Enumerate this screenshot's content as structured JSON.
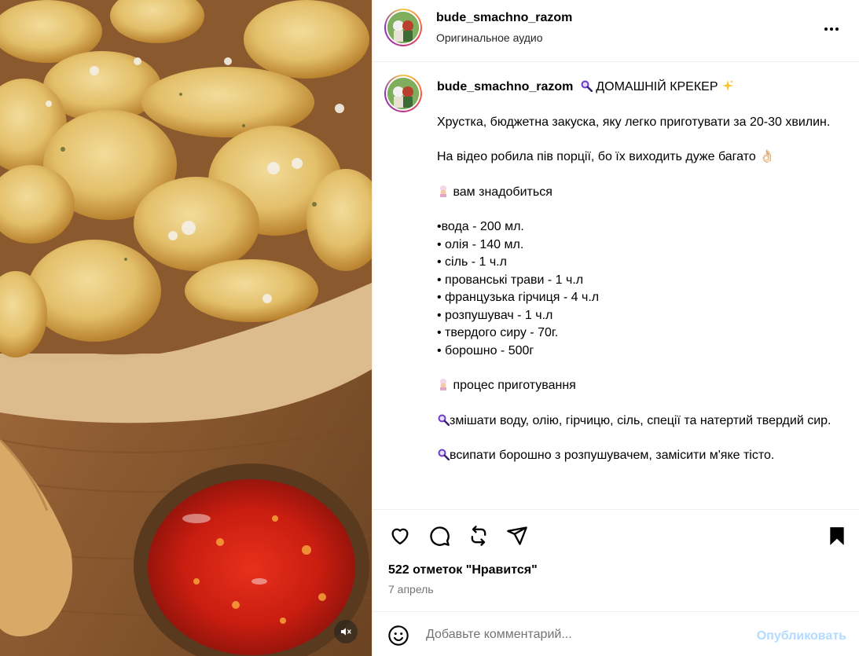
{
  "header": {
    "username": "bude_smachno_razom",
    "audio": "Оригинальное аудио"
  },
  "caption": {
    "username": "bude_smachno_razom",
    "title": "ДОМАШНІЙ КРЕКЕР",
    "intro": "Хрустка, бюджетна закуска, яку легко приготувати за 20-30 хвилин.",
    "note": "На відео робила пів порції, бо їх виходить дуже багато 👌🏻",
    "need_heading": "вам знадобиться",
    "ingredients": [
      "•вода - 200 мл.",
      "• олія - 140 мл.",
      "• сіль - 1 ч.л",
      "• прованські трави - 1 ч.л",
      "• французька гірчиця - 4 ч.л",
      "• розпушувач - 1 ч.л",
      "• твердого сиру - 70г.",
      "• борошно - 500г"
    ],
    "process_heading": " процес приготування",
    "step1": "змішати воду, олію, гірчицю, сіль, спеції та натертий твердий сир.",
    "step2": "всипати борошно з розпушувачем, замісити м'яке тісто."
  },
  "post": {
    "likes": "522 отметок \"Нравится\"",
    "date": "7 апрель"
  },
  "comment": {
    "placeholder": "Добавьте комментарий...",
    "post_label": "Опубликовать"
  },
  "icons": {
    "more": "more-horizontal-icon",
    "like": "heart-icon",
    "comment": "comment-bubble-icon",
    "repost": "repost-icon",
    "share": "send-icon",
    "save": "bookmark-filled-icon",
    "emoji": "smiley-icon",
    "mute": "speaker-muted-icon"
  },
  "colors": {
    "post_button": "#b3dbff",
    "secondary_text": "#737373",
    "divider": "#efefef"
  }
}
